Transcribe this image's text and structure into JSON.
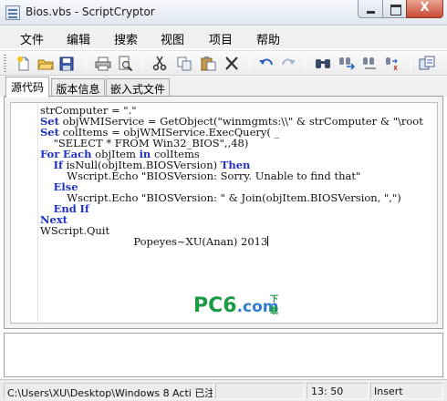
{
  "window": {
    "title": "Bios.vbs - ScriptCryptor",
    "close_label": "X"
  },
  "menu": {
    "items": [
      "文件",
      "编辑",
      "搜索",
      "视图",
      "项目",
      "帮助"
    ]
  },
  "toolbar": {
    "buttons": [
      "new-file",
      "open-folder",
      "save",
      "print",
      "print-preview",
      "cut",
      "copy",
      "paste",
      "delete",
      "undo",
      "redo",
      "find",
      "find-next",
      "replace",
      "replace-all",
      "project-settings"
    ]
  },
  "tabs": {
    "items": [
      "源代码",
      "版本信息",
      "嵌入式文件"
    ],
    "active_index": 0
  },
  "editor": {
    "lines": [
      [
        {
          "t": "strComputer = \".\""
        }
      ],
      [
        {
          "t": "Set",
          "k": true
        },
        {
          "t": " objWMIService = GetObject(\"winmgmts:\\\\\" & strComputer & \"\\root"
        }
      ],
      [
        {
          "t": "Set",
          "k": true
        },
        {
          "t": " colItems = objWMIService.ExecQuery( _"
        }
      ],
      [
        {
          "t": "    \"SELECT * FROM Win32_BIOS\",,48)"
        }
      ],
      [
        {
          "t": "For",
          "k": true
        },
        {
          "t": " "
        },
        {
          "t": "Each",
          "k": true
        },
        {
          "t": " objItem "
        },
        {
          "t": "in",
          "k": true
        },
        {
          "t": " colItems"
        }
      ],
      [
        {
          "t": "    "
        },
        {
          "t": "If",
          "k": true
        },
        {
          "t": " isNull(objItem.BIOSVersion) "
        },
        {
          "t": "Then",
          "k": true
        }
      ],
      [
        {
          "t": "        Wscript.Echo \"BIOSVersion: Sorry. Unable to find that\""
        }
      ],
      [
        {
          "t": "    "
        },
        {
          "t": "Else",
          "k": true
        }
      ],
      [
        {
          "t": "        Wscript.Echo \"BIOSVersion: \" & Join(objItem.BIOSVersion, \",\")"
        }
      ],
      [
        {
          "t": "    "
        },
        {
          "t": "End",
          "k": true
        },
        {
          "t": " "
        },
        {
          "t": "If",
          "k": true
        }
      ],
      [
        {
          "t": "Next",
          "k": true
        }
      ],
      [
        {
          "t": "WScript.Quit"
        }
      ],
      [
        {
          "t": "                            Popeyes~XU(Anan) 2013"
        }
      ]
    ],
    "watermark": {
      "pc": "PC",
      "six": "6",
      "com": ".com",
      "download": "下载"
    }
  },
  "status": {
    "path": "C:\\Users\\XU\\Desktop\\Windows 8 Acti",
    "registered": "已注册",
    "position": "13: 50",
    "mode": "Insert"
  }
}
